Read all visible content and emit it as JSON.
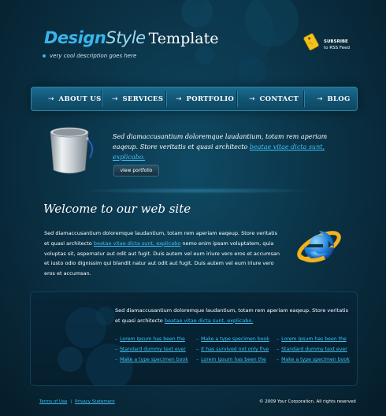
{
  "logo": {
    "design": "Design",
    "style": "Style",
    "template": "Template"
  },
  "tagline": "very cool description goes here",
  "rss": {
    "title": "SUBSRIBE",
    "subtitle": "to RSS Feed",
    "icon": "rss-tag-icon"
  },
  "nav": {
    "items": [
      {
        "label": "ABOUT US"
      },
      {
        "label": "SERVICES"
      },
      {
        "label": "PORTFOLIO"
      },
      {
        "label": "CONTACT"
      },
      {
        "label": "BLOG"
      }
    ],
    "arrow": "→"
  },
  "hero": {
    "text_plain": "Sed diamaccusantium doloremque laudantium, totam rem aperiam eaqeup. Store veritatis et quasi architecto ",
    "link": "beatae vitae dicta sunt, explicabo.",
    "button": "view portfolio"
  },
  "welcome": {
    "title": "Welcome to our web site",
    "para_part1": "Sed diamaccusantium doloremque laudantium, totam rem aperiam eaqeup. Store veritatis et quasi architecto ",
    "para_link": "beatae vitae dicta sunt, explicabo",
    "para_part2": " nemo enim ipsam voluptatem, quia voluptas sit, aspernatur aut odit aut fugit. Duis autem vel eum iriure vero eros et accumsan et iusto odio dignissim qui blandit natur aut odit aut fugit. Duis autem vel eum iriure vero eros et accumsan."
  },
  "panel": {
    "text_plain": "Sed diamaccusantium doloremque laudantium, totam rem aperiam eaqeup. Store veritatis et quasi architecto ",
    "link": "beatae vitae dicta sunt, explicabo.",
    "columns": [
      [
        "Lorem Ipsum has been the",
        "Standard dummy text ever",
        "Make a type specimen book"
      ],
      [
        "Make a type specimen book",
        "It has survived not only five",
        "Lorem Ipsum has been the"
      ],
      [
        "Lorem Ipsum has been the",
        "Standard dummy text ever",
        "Make a type specimen book"
      ]
    ],
    "dash": "–"
  },
  "footer": {
    "terms": "Terms of Use",
    "separator": "|",
    "privacy": "Privacy Statement",
    "copyright": "© 2009 Your Corporation. All rights reserved"
  },
  "colors": {
    "accent": "#3ab4ea",
    "link": "#3ec0f2",
    "background": "#0b3448",
    "panel": "#072638"
  }
}
